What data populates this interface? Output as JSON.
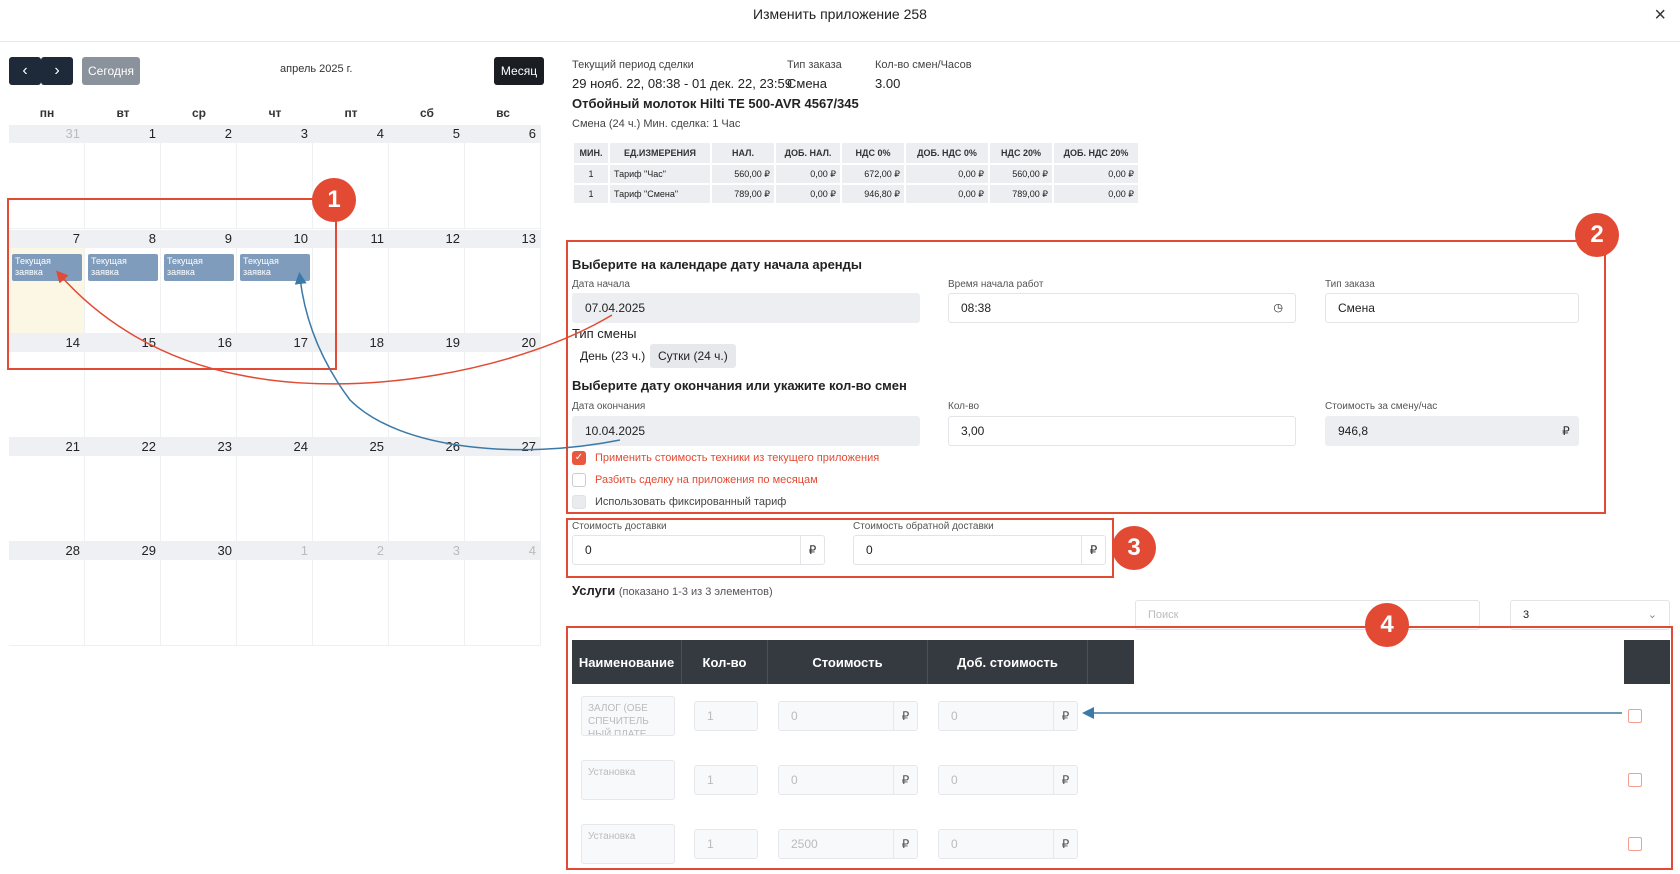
{
  "modal": {
    "title": "Изменить приложение 258",
    "close_icon": "×"
  },
  "calendar": {
    "prev": "‹",
    "next": "›",
    "today": "Сегодня",
    "month_label": "апрель 2025 г.",
    "view": "Месяц",
    "weekdays": [
      "пн",
      "вт",
      "ср",
      "чт",
      "пт",
      "сб",
      "вс"
    ],
    "weeks": [
      [
        "31",
        "1",
        "2",
        "3",
        "4",
        "5",
        "6"
      ],
      [
        "7",
        "8",
        "9",
        "10",
        "11",
        "12",
        "13"
      ],
      [
        "14",
        "15",
        "16",
        "17",
        "18",
        "19",
        "20"
      ],
      [
        "21",
        "22",
        "23",
        "24",
        "25",
        "26",
        "27"
      ],
      [
        "28",
        "29",
        "30",
        "1",
        "2",
        "3",
        "4"
      ]
    ],
    "event_label": "Текущая заявка"
  },
  "deal": {
    "period_label": "Текущий период сделки",
    "period_value": "29 нояб. 22, 08:38 - 01 дек. 22, 23:59",
    "type_label": "Тип заказа",
    "type_value": "Смена",
    "count_label": "Кол-во смен/Часов",
    "count_value": "3.00",
    "equipment": "Отбойный молоток Hilti TE 500-AVR 4567/345",
    "shift_info": "Смена (24 ч.) Мин. сделка: 1 Час"
  },
  "price_table": {
    "headers": [
      "МИН.",
      "ЕД.ИЗМЕРЕНИЯ",
      "НАЛ.",
      "ДОБ. НАЛ.",
      "НДС 0%",
      "ДОБ. НДС 0%",
      "НДС 20%",
      "ДОБ. НДС 20%"
    ],
    "rows": [
      [
        "1",
        "Тариф \"Час\"",
        "560,00 ₽",
        "0,00 ₽",
        "672,00 ₽",
        "0,00 ₽",
        "560,00 ₽",
        "0,00 ₽"
      ],
      [
        "1",
        "Тариф \"Смена\"",
        "789,00 ₽",
        "0,00 ₽",
        "946,80 ₽",
        "0,00 ₽",
        "789,00 ₽",
        "0,00 ₽"
      ]
    ]
  },
  "form": {
    "start_heading": "Выберите на календаре дату начала аренды",
    "start_date_label": "Дата начала",
    "start_date_value": "07.04.2025",
    "start_time_label": "Время начала работ",
    "start_time_value": "08:38",
    "order_type_label": "Тип заказа",
    "order_type_value": "Смена",
    "shift_type_label": "Тип смены",
    "shift_day": "День (23 ч.)",
    "shift_full": "Сутки (24 ч.)",
    "end_heading": "Выберите дату окончания или укажите кол-во смен",
    "end_date_label": "Дата окончания",
    "end_date_value": "10.04.2025",
    "qty_label": "Кол-во",
    "qty_value": "3,00",
    "cost_label": "Стоимость за смену/час",
    "cost_value": "946,8",
    "currency": "₽",
    "cb1": "Применить стоимость техники из текущего приложения",
    "cb2": "Разбить сделку на приложения по месяцам",
    "cb3": "Использовать фиксированный тариф"
  },
  "delivery": {
    "label": "Стоимость доставки",
    "value": "0",
    "return_label": "Стоимость обратной доставки",
    "return_value": "0"
  },
  "services": {
    "title": "Услуги",
    "subtitle": "(показано 1-3 из 3 элементов)",
    "search_placeholder": "Поиск",
    "page_size": "3",
    "headers": [
      "Наименование",
      "Кол-во",
      "Стоимость",
      "Доб. стоимость"
    ],
    "rows": [
      {
        "name": "ЗАЛОГ (ОБЕ СПЕЧИТЕЛЬ НЫЙ ПЛАТЕ",
        "qty": "1",
        "cost": "0",
        "extra": "0"
      },
      {
        "name": "Установка",
        "qty": "1",
        "cost": "0",
        "extra": "0"
      },
      {
        "name": "Установка",
        "qty": "1",
        "cost": "2500",
        "extra": "0"
      }
    ]
  },
  "annotations": {
    "b1": "1",
    "b2": "2",
    "b3": "3",
    "b4": "4",
    "accent": "#e24a33"
  }
}
